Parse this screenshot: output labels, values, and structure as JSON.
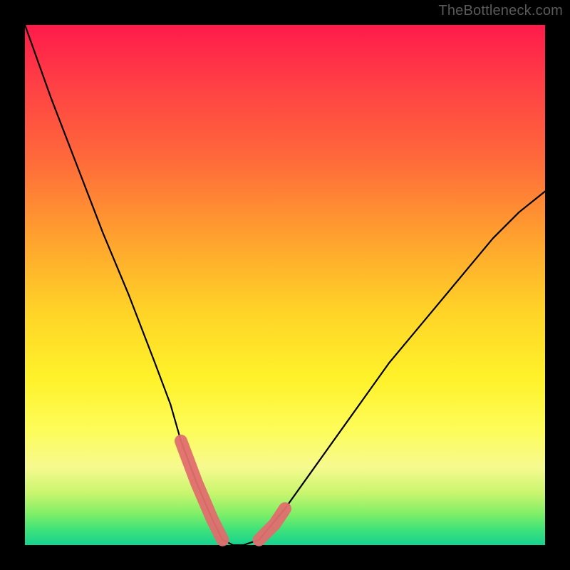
{
  "watermark": "TheBottleneck.com",
  "chart_data": {
    "type": "line",
    "title": "",
    "xlabel": "",
    "ylabel": "",
    "xlim": [
      0,
      100
    ],
    "ylim": [
      0,
      100
    ],
    "grid": false,
    "legend": null,
    "series": [
      {
        "name": "bottleneck-curve",
        "x": [
          0,
          5,
          10,
          15,
          20,
          25,
          28,
          30,
          33,
          36,
          38,
          40,
          42,
          45,
          50,
          55,
          60,
          65,
          70,
          75,
          80,
          85,
          90,
          95,
          100
        ],
        "values": [
          100,
          86,
          73,
          60,
          48,
          35,
          27,
          20,
          12,
          5,
          1,
          0,
          0,
          1,
          7,
          14,
          21,
          28,
          35,
          41,
          47,
          53,
          59,
          64,
          68
        ]
      }
    ],
    "highlights": [
      {
        "name": "left-marker-segment",
        "x": [
          30,
          33,
          36,
          38
        ],
        "values": [
          20,
          12,
          5,
          1
        ]
      },
      {
        "name": "right-marker-segment",
        "x": [
          45,
          48,
          50
        ],
        "values": [
          1,
          4,
          7
        ]
      }
    ],
    "background_gradient": {
      "top": "#ff1a4b",
      "mid": "#fff22a",
      "bottom": "#17d28f"
    }
  }
}
